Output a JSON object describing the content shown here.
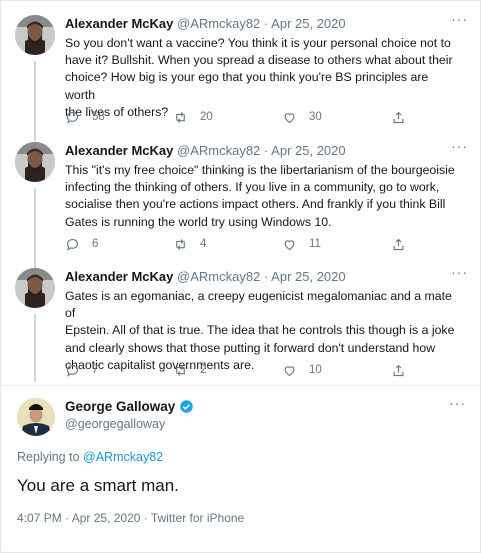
{
  "thread": [
    {
      "name": "Alexander McKay",
      "handle": "@ARmckay82",
      "sep": "·",
      "date": "Apr 25, 2020",
      "more": "···",
      "lines": [
        "So you don't want a vaccine?  You think it is your personal choice not to",
        "have it?  Bullshit.  When you spread a disease to others what about their",
        "choice?  How big is your ego that you think you're BS principles are worth",
        "the lives of others?"
      ],
      "replies": "58",
      "retweets": "20",
      "likes": "30"
    },
    {
      "name": "Alexander McKay",
      "handle": "@ARmckay82",
      "sep": "·",
      "date": "Apr 25, 2020",
      "more": "···",
      "lines": [
        "This \"it's my free choice\" thinking is the libertarianism of the bourgeoisie",
        "infecting the thinking of others.  If you live in a community, go to work,",
        "socialise then you're actions impact others.  And frankly if you think Bill",
        "Gates is running the world try using Windows 10."
      ],
      "replies": "6",
      "retweets": "4",
      "likes": "11"
    },
    {
      "name": "Alexander McKay",
      "handle": "@ARmckay82",
      "sep": "·",
      "date": "Apr 25, 2020",
      "more": "···",
      "lines": [
        "Gates is an egomaniac, a creepy eugenicist megalomaniac and a mate of",
        "Epstein.  All of that is true.  The idea that he controls this though is a joke",
        "and clearly shows that those putting it forward don't understand how",
        "chaotic capitalist governments are."
      ],
      "replies": "7",
      "retweets": "2",
      "likes": "10"
    }
  ],
  "main": {
    "name": "George Galloway",
    "handle": "@georgegalloway",
    "more": "···",
    "replying_prefix": "Replying to",
    "replying_to": "@ARmckay82",
    "text": "You are a smart man.",
    "meta": "4:07 PM · Apr 25, 2020 · Twitter for iPhone"
  },
  "colors": {
    "text": "#14171a",
    "secondary": "#657786",
    "link": "#1b95e0",
    "verified": "#1da1f2",
    "divider": "#e6ecf0"
  }
}
